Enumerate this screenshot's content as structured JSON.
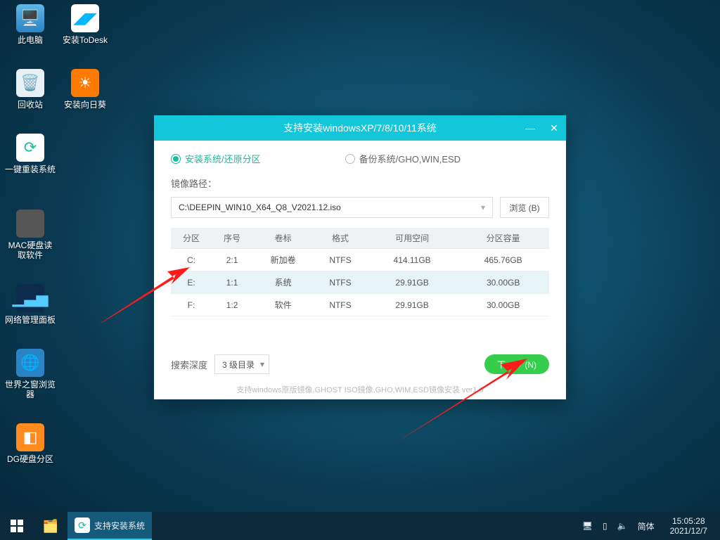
{
  "desktop_icons": [
    {
      "id": "pc",
      "label": "此电脑"
    },
    {
      "id": "todesk",
      "label": "安装ToDesk"
    },
    {
      "id": "bin",
      "label": "回收站"
    },
    {
      "id": "sunflower",
      "label": "安装向日葵"
    },
    {
      "id": "reinstall",
      "label": "一键重装系统"
    },
    {
      "id": "mac",
      "label": "MAC硬盘读取软件"
    },
    {
      "id": "netpanel",
      "label": "网络管理面板"
    },
    {
      "id": "world",
      "label": "世界之窗浏览器"
    },
    {
      "id": "dg",
      "label": "DG硬盘分区"
    }
  ],
  "taskbar": {
    "active_task": "支持安装系统",
    "ime": "简体",
    "time": "15:05:28",
    "date": "2021/12/7"
  },
  "window": {
    "title": "支持安装windowsXP/7/8/10/11系统",
    "opt_install": "安装系统/还原分区",
    "opt_backup": "备份系统/GHO,WIN,ESD",
    "path_label": "镜像路径：",
    "path_value": "C:\\DEEPIN_WIN10_X64_Q8_V2021.12.iso",
    "browse": "浏览 (B)",
    "headers": {
      "part": "分区",
      "seq": "序号",
      "vol": "卷标",
      "fs": "格式",
      "free": "可用空间",
      "size": "分区容量"
    },
    "rows": [
      {
        "part": "C:",
        "seq": "2:1",
        "vol": "新加卷",
        "fs": "NTFS",
        "free": "414.11GB",
        "size": "465.76GB"
      },
      {
        "part": "E:",
        "seq": "1:1",
        "vol": "系统",
        "fs": "NTFS",
        "free": "29.91GB",
        "size": "30.00GB"
      },
      {
        "part": "F:",
        "seq": "1:2",
        "vol": "软件",
        "fs": "NTFS",
        "free": "29.91GB",
        "size": "30.00GB"
      }
    ],
    "depth_label": "搜索深度",
    "depth_value": "3 级目录",
    "next": "下一步 (N)",
    "hint": "支持windows原版镜像,GHOST ISO镜像,GHO,WIM,ESD镜像安装 ver1.0"
  }
}
